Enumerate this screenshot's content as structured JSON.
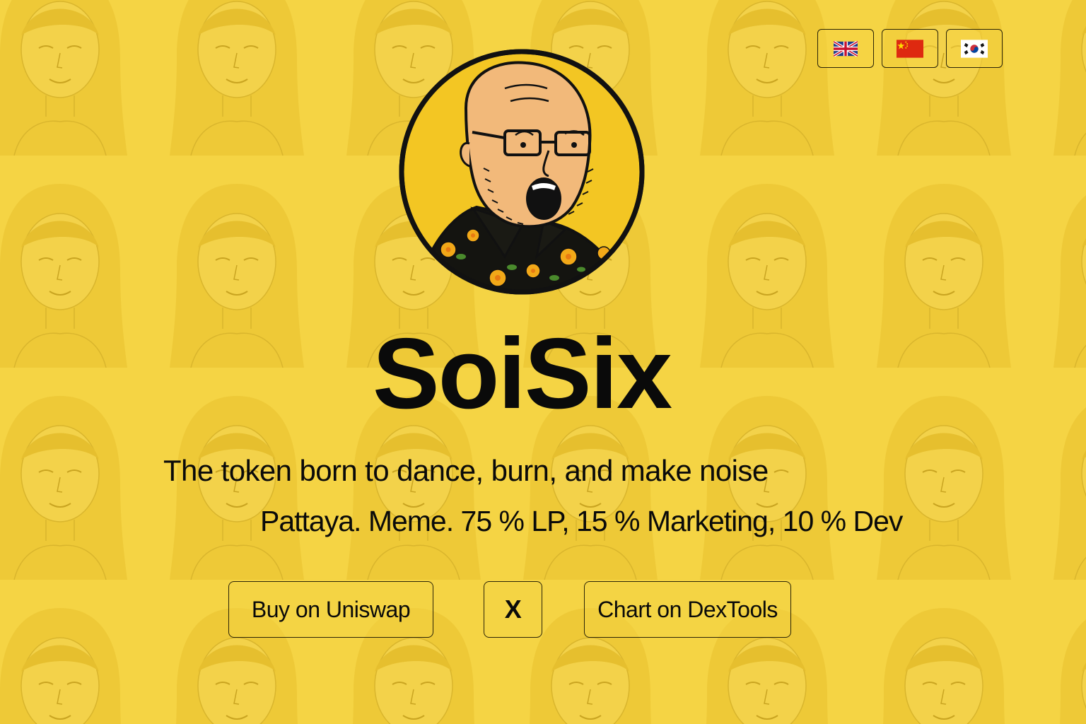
{
  "header": {
    "languages": [
      {
        "code": "en",
        "flag": "uk-flag-icon"
      },
      {
        "code": "zh",
        "flag": "china-flag-icon"
      },
      {
        "code": "ko",
        "flag": "korea-flag-icon"
      }
    ]
  },
  "hero": {
    "title": "SoiSix",
    "tagline": "The token born to dance, burn, and make noise",
    "subline": "Pattaya. Meme. 75 % LP, 15 % Marketing, 10 % Dev"
  },
  "actions": {
    "buy_label": "Buy on Uniswap",
    "x_label": "X",
    "chart_label": "Chart on DexTools"
  },
  "colors": {
    "background": "#f5d444",
    "pattern": "#e8c330",
    "text": "#0a0a0a",
    "skin": "#f2b97a"
  }
}
